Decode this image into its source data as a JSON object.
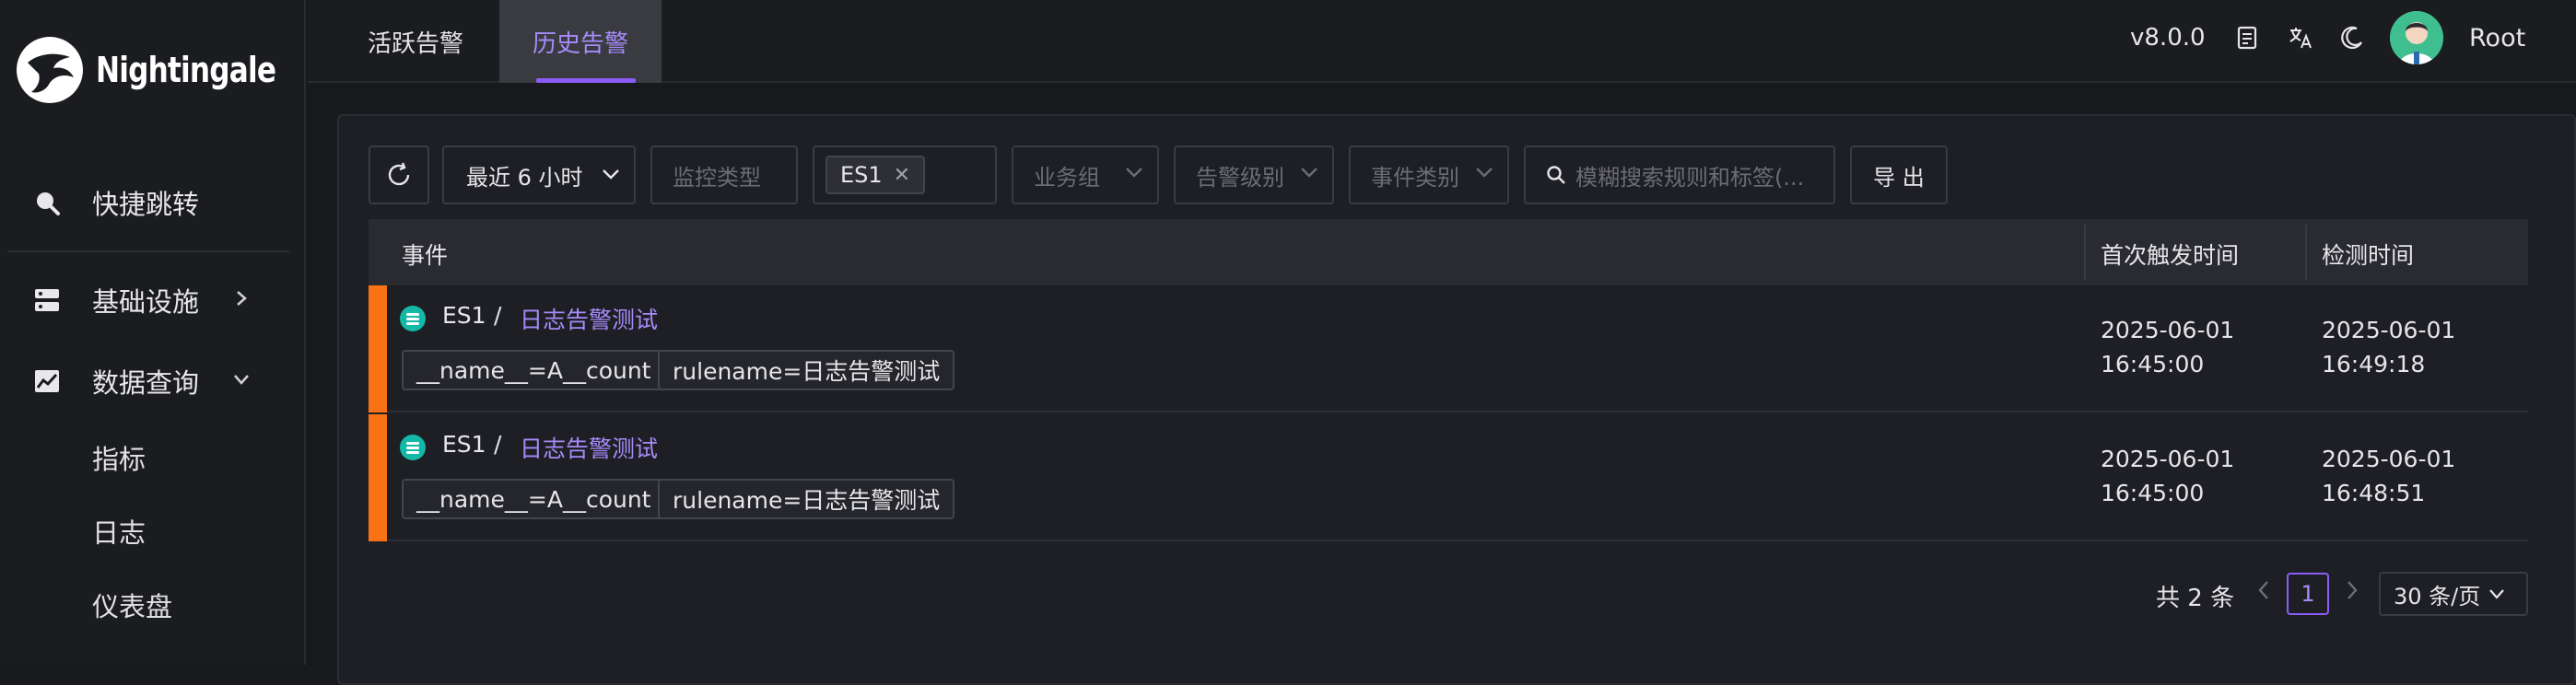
{
  "app": {
    "name": "Nightingale"
  },
  "sidebar": {
    "items": [
      {
        "label": "快捷跳转",
        "icon": "search-icon"
      },
      {
        "label": "基础设施",
        "icon": "server-icon",
        "chevron": "chevron-right-icon"
      },
      {
        "label": "数据查询",
        "icon": "chart-line-icon",
        "chevron": "chevron-down-icon"
      }
    ],
    "sub_items": [
      "指标",
      "日志",
      "仪表盘"
    ]
  },
  "header": {
    "tabs": [
      {
        "label": "活跃告警",
        "active": false
      },
      {
        "label": "历史告警",
        "active": true
      }
    ],
    "version": "v8.0.0",
    "icons": [
      "notes-icon",
      "translate-icon",
      "moon-icon"
    ],
    "user": "Root"
  },
  "filters": {
    "refresh_icon": "refresh-icon",
    "time_range": "最近 6 小时",
    "monitor_type_placeholder": "监控类型",
    "datasource_tag": "ES1",
    "business_group": "业务组",
    "severity": "告警级别",
    "event_type": "事件类别",
    "search_placeholder": "模糊搜索规则和标签(...",
    "export_label": "导 出"
  },
  "table": {
    "columns": [
      "事件",
      "首次触发时间",
      "检测时间"
    ],
    "rows": [
      {
        "datasource": "ES1",
        "separator": "/",
        "rule": "日志告警测试",
        "labels": [
          "__name__=A__count",
          "rulename=日志告警测试"
        ],
        "first_date": "2025-06-01",
        "first_time": "16:45:00",
        "check_date": "2025-06-01",
        "check_time": "16:49:18",
        "severity_color": "#f97316"
      },
      {
        "datasource": "ES1",
        "separator": "/",
        "rule": "日志告警测试",
        "labels": [
          "__name__=A__count",
          "rulename=日志告警测试"
        ],
        "first_date": "2025-06-01",
        "first_time": "16:45:00",
        "check_date": "2025-06-01",
        "check_time": "16:48:51",
        "severity_color": "#f97316"
      }
    ]
  },
  "pagination": {
    "total": "共 2 条",
    "current_page": "1",
    "page_size": "30 条/页"
  },
  "colors": {
    "accent": "#8b5cf6",
    "accent_text": "#a78bfa",
    "severity_orange": "#f97316",
    "background": "#18191d"
  }
}
